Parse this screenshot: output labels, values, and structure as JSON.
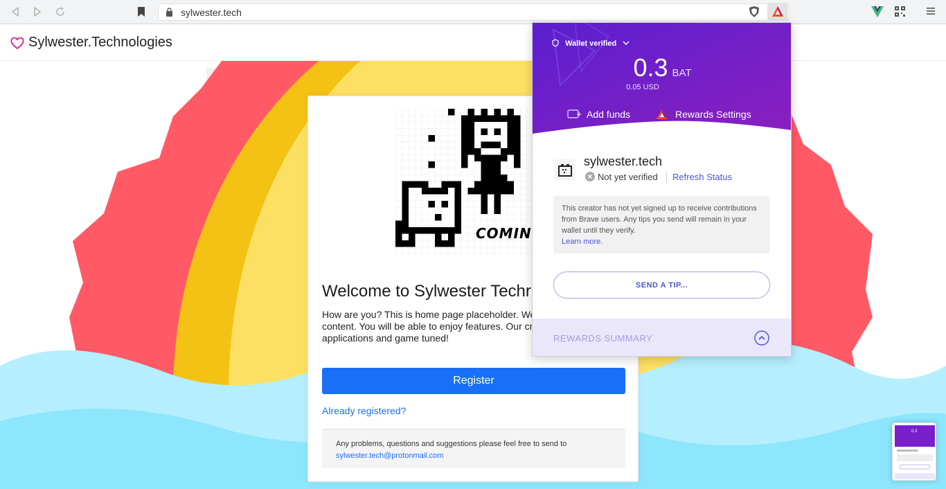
{
  "browser": {
    "url": "sylwester.tech",
    "icons": [
      "back-icon",
      "forward-icon",
      "reload-icon",
      "bookmark-icon",
      "lock-icon",
      "brave-shield-icon",
      "bat-rewards-icon",
      "vue-devtools-icon",
      "qr-code-icon",
      "menu-icon"
    ]
  },
  "site": {
    "brand": "Sylwester.Technologies",
    "card": {
      "art_caption": "COMING",
      "title": "Welcome to Sylwester Techr",
      "intro": "How are you? This is home page placeholder. We hard on relevant content. You will be able to enjoy features. Our crossplatform applications and game tuned!",
      "register_label": "Register",
      "already_label": "Already registered?",
      "contact_text": "Any problems, questions and suggestions please feel free to send to",
      "contact_email": "sylwester.tech@protonmail.com"
    },
    "colors": {
      "sun_red": "#ff5a65",
      "sun_orange": "#f4c214",
      "sun_yellow": "#fde063",
      "sea": "#b5efff",
      "accent": "#1a6ff7"
    }
  },
  "rewards": {
    "wallet_label": "Wallet verified",
    "balance": "0.3",
    "currency": "BAT",
    "usd": "0.05 USD",
    "add_funds": "Add funds",
    "settings": "Rewards Settings",
    "publisher_name": "sylwester.tech",
    "publisher_status": "Not yet verified",
    "refresh": "Refresh Status",
    "notice": "This creator has not yet signed up to receive contributions from Brave users. Any tips you send will remain in your wallet until they verify.",
    "learn_more": "Learn more.",
    "tip_button": "SEND A TIP...",
    "summary": "REWARDS SUMMARY",
    "colors": {
      "header_from": "#5a1fd1",
      "header_to": "#8b1fbf",
      "link": "#4c54d2"
    }
  },
  "thumbnail": {
    "balance": "0.3"
  }
}
